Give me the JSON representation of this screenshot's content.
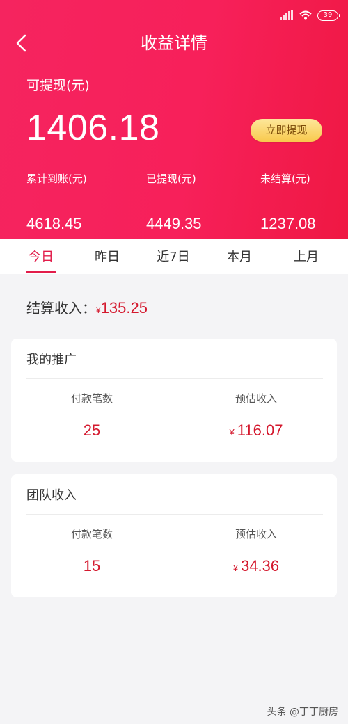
{
  "status_bar": {
    "battery": "39"
  },
  "header": {
    "title": "收益详情",
    "available_label": "可提现(元)",
    "available_amount": "1406.18",
    "withdraw_button": "立即提现",
    "stats": [
      {
        "label": "累计到账(元)",
        "value": "4618.45"
      },
      {
        "label": "已提现(元)",
        "value": "4449.35"
      },
      {
        "label": "未结算(元)",
        "value": "1237.08"
      }
    ]
  },
  "tabs": [
    {
      "label": "今日",
      "active": true
    },
    {
      "label": "昨日",
      "active": false
    },
    {
      "label": "近7日",
      "active": false
    },
    {
      "label": "本月",
      "active": false
    },
    {
      "label": "上月",
      "active": false
    }
  ],
  "settlement": {
    "label": "结算收入：",
    "currency": "¥",
    "amount": "135.25"
  },
  "cards": [
    {
      "title": "我的推广",
      "count_label": "付款笔数",
      "count_value": "25",
      "income_label": "预估收入",
      "income_currency": "¥",
      "income_value": "116.07"
    },
    {
      "title": "团队收入",
      "count_label": "付款笔数",
      "count_value": "15",
      "income_label": "预估收入",
      "income_currency": "¥",
      "income_value": "34.36"
    }
  ],
  "watermark": "头条 @丁丁厨房",
  "colors": {
    "header_gradient_start": "#f5245f",
    "header_gradient_end": "#ef1843",
    "accent_red": "#e21c4a",
    "amount_red": "#d4192e",
    "button_gold": "#f8c94d"
  }
}
